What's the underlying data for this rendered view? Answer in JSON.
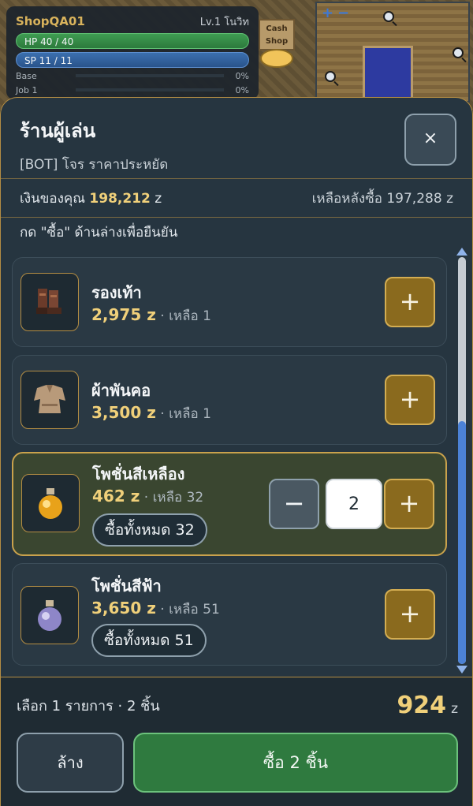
{
  "hud": {
    "char_name": "ShopQA01",
    "char_level": "Lv.1 โนวิท",
    "hp": "HP 40 / 40",
    "sp": "SP 11 / 11",
    "base_label": "Base",
    "base_pct": "0%",
    "job_label": "Job 1",
    "job_pct": "0%",
    "cash_shop": "Cash Shop"
  },
  "shop": {
    "title": "ร้านผู้เล่น",
    "subtitle": "[BOT] โจร ราคาประหยัด",
    "close_label": "×",
    "your_money_label": "เงินของคุณ",
    "your_money": "198,212",
    "currency": "z",
    "after_label": "เหลือหลังซื้อ",
    "after_amount": "197,288 z",
    "hint": "กด \"ซื้อ\" ด้านล่างเพื่อยืนยัน",
    "plus_label": "+",
    "minus_label": "−",
    "items": [
      {
        "name": "รองเท้า",
        "price": "2,975 z",
        "stock": "· เหลือ 1",
        "icon": "boots-icon"
      },
      {
        "name": "ผ้าพันคอ",
        "price": "3,500 z",
        "stock": "· เหลือ 1",
        "icon": "cloak-icon"
      },
      {
        "name": "โพชั่นสีเหลือง",
        "price": "462 z",
        "stock": "· เหลือ 32",
        "icon": "yellow-potion-icon",
        "buy_all": "ซื้อทั้งหมด 32",
        "qty": "2"
      },
      {
        "name": "โพชั่นสีฟ้า",
        "price": "3,650 z",
        "stock": "· เหลือ 51",
        "icon": "blue-potion-icon",
        "buy_all": "ซื้อทั้งหมด 51"
      }
    ]
  },
  "footer": {
    "summary": "เลือก 1 รายการ · 2 ชิ้น",
    "total": "924",
    "total_unit": "z",
    "clear_label": "ล้าง",
    "buy_label": "ซื้อ 2 ชิ้น"
  },
  "colors": {
    "accent_gold": "#f0d07a",
    "buy_green": "#2f7a3f",
    "panel": "#263540"
  }
}
